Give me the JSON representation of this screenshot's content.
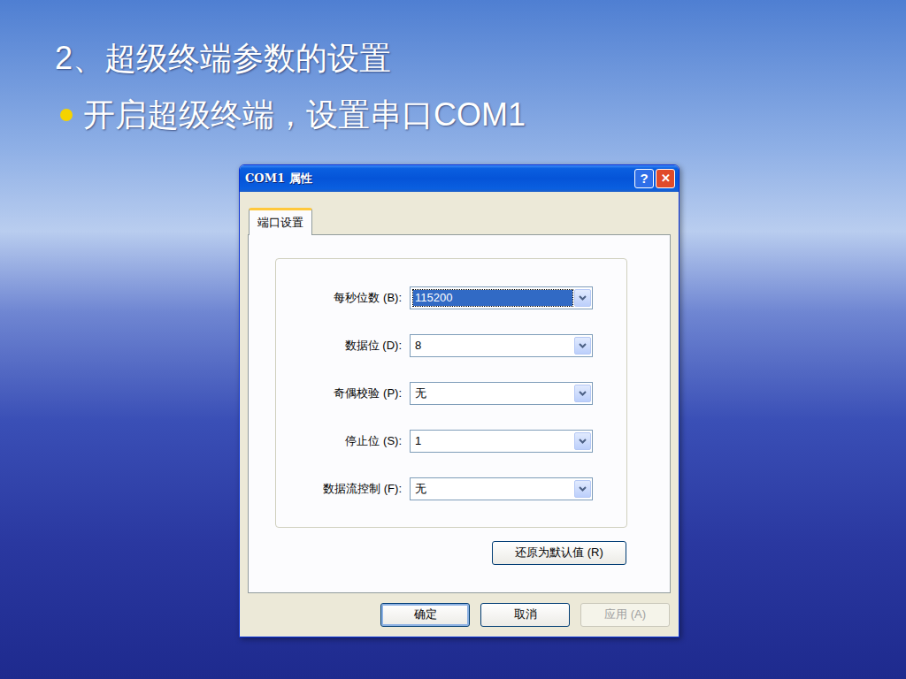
{
  "slide": {
    "title": "2、超级终端参数的设置",
    "bullets": [
      {
        "text": "开启超级终端，设置串口COM1"
      }
    ]
  },
  "window": {
    "title": "COM1 属性",
    "help": "?",
    "close": "✕"
  },
  "tabs": [
    {
      "label": "端口设置",
      "selected": true
    }
  ],
  "fields": [
    {
      "label": "每秒位数 (B):",
      "value": "115200",
      "focused": true
    },
    {
      "label": "数据位 (D):",
      "value": "8",
      "focused": false
    },
    {
      "label": "奇偶校验 (P):",
      "value": "无",
      "focused": false
    },
    {
      "label": "停止位 (S):",
      "value": "1",
      "focused": false
    },
    {
      "label": "数据流控制 (F):",
      "value": "无",
      "focused": false
    }
  ],
  "restore_button": {
    "label": "还原为默认值 (R)",
    "disabled": false
  },
  "buttons": [
    {
      "label": "确定",
      "default": true,
      "disabled": false
    },
    {
      "label": "取消",
      "default": false,
      "disabled": false
    },
    {
      "label": "应用 (A)",
      "default": false,
      "disabled": true
    }
  ]
}
